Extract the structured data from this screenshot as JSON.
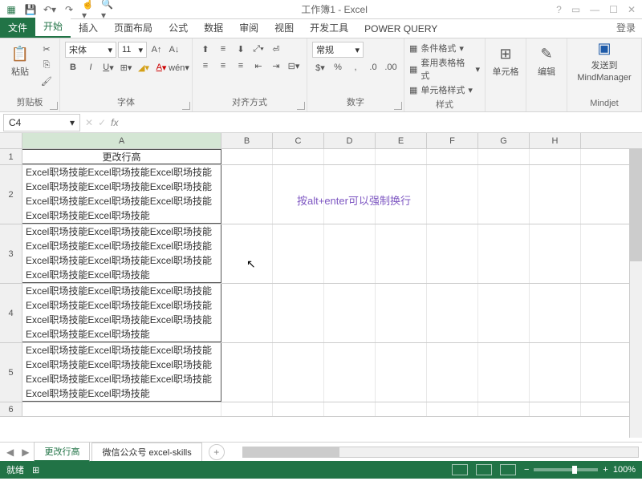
{
  "title": "工作簿1 - Excel",
  "login": "登录",
  "tabs": {
    "file": "文件",
    "home": "开始",
    "insert": "插入",
    "layout": "页面布局",
    "formulas": "公式",
    "data": "数据",
    "review": "审阅",
    "view": "视图",
    "dev": "开发工具",
    "pq": "POWER QUERY"
  },
  "ribbon": {
    "clipboard": {
      "label": "剪贴板",
      "paste": "粘贴"
    },
    "font": {
      "label": "字体",
      "name": "宋体",
      "size": "11"
    },
    "align": {
      "label": "对齐方式"
    },
    "number": {
      "label": "数字",
      "format": "常规"
    },
    "styles": {
      "label": "样式",
      "cond": "条件格式",
      "tbl": "套用表格格式",
      "cell": "单元格样式"
    },
    "cells": {
      "label": "单元格"
    },
    "editing": {
      "label": "编辑"
    },
    "mindjet": {
      "label": "Mindjet",
      "send": "发送到",
      "mm": "MindManager"
    }
  },
  "namebox": "C4",
  "columns": [
    "A",
    "B",
    "C",
    "D",
    "E",
    "F",
    "G",
    "H"
  ],
  "rowHeader": "更改行高",
  "cellText": "Excel职场技能Excel职场技能Excel职场技能Excel职场技能Excel职场技能Excel职场技能Excel职场技能Excel职场技能Excel职场技能Excel职场技能Excel职场技能",
  "floating": "按alt+enter可以强制换行",
  "sheets": {
    "s1": "更改行高",
    "s2": "微信公众号 excel-skills"
  },
  "status": {
    "ready": "就绪",
    "caps": "",
    "zoom": "100%"
  }
}
